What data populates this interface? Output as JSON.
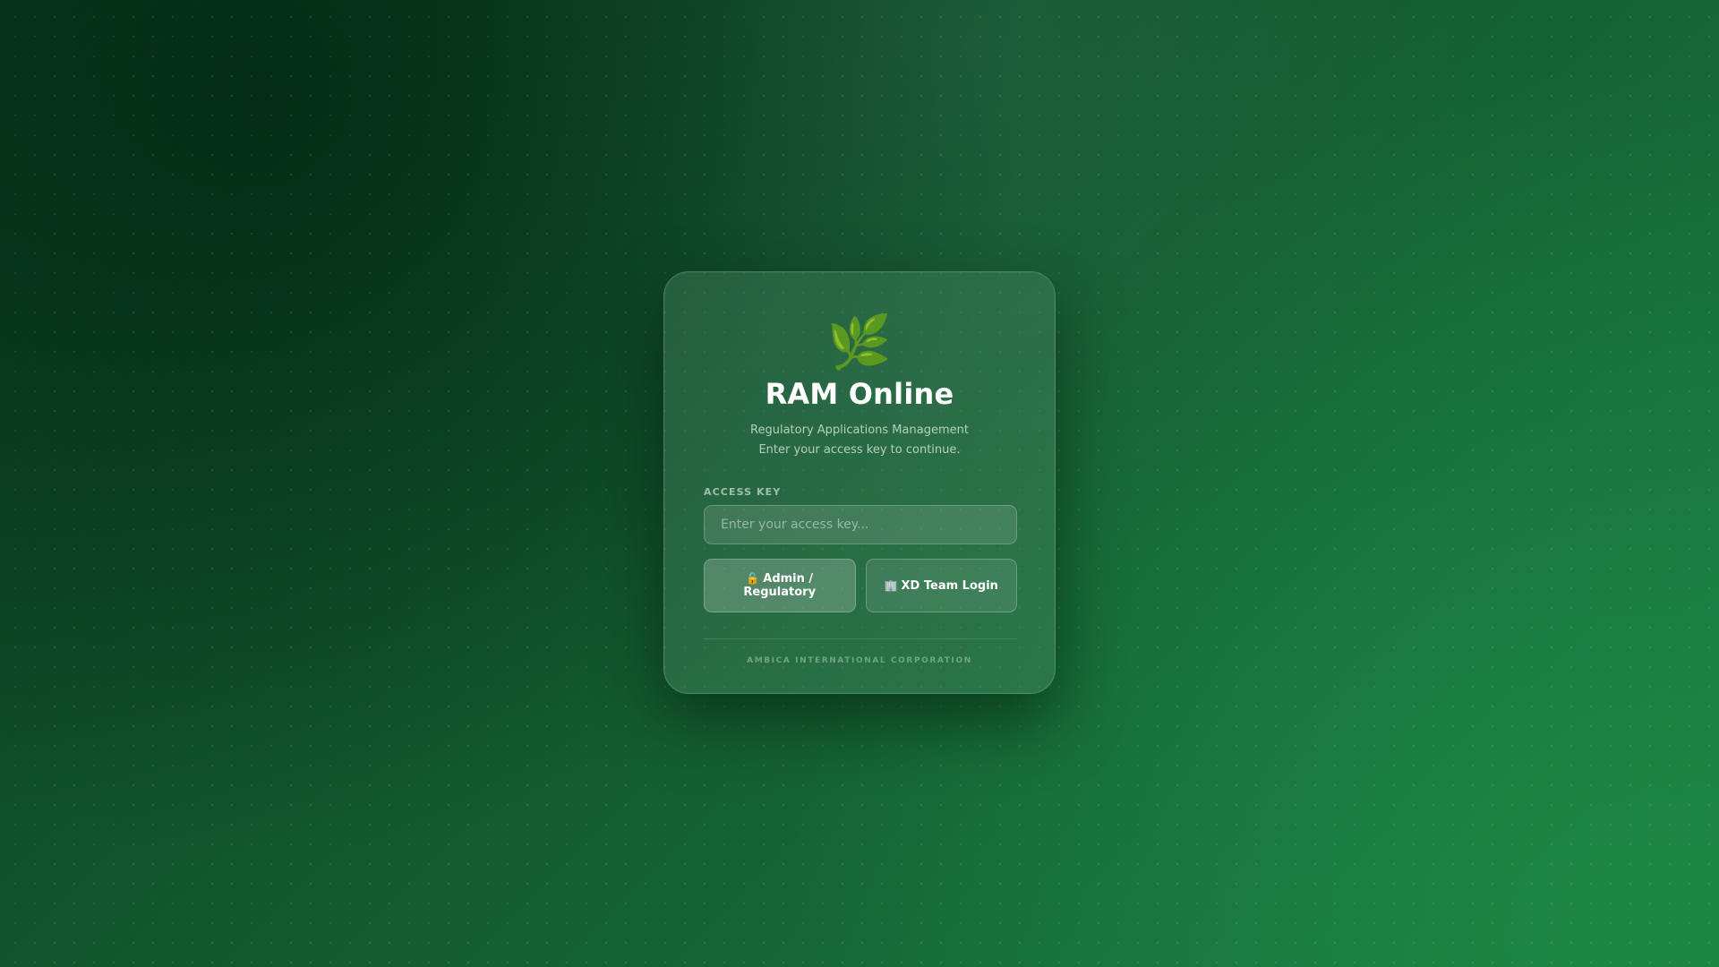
{
  "app": {
    "logo_icon": "🌿",
    "title": "RAM Online",
    "subtitle": "Regulatory Applications Management",
    "instruction": "Enter your access key to continue."
  },
  "form": {
    "access_key_label": "ACCESS KEY",
    "access_key_placeholder": "Enter your access key...",
    "access_key_value": ""
  },
  "buttons": {
    "admin_icon": "🔓",
    "admin_label": "Admin / Regulatory",
    "team_icon": "🏢",
    "team_label": "XD Team Login"
  },
  "footer": {
    "company": "AMBICA INTERNATIONAL CORPORATION"
  },
  "colors": {
    "background_dark": "#0a3a20",
    "background_light": "#1a7a42",
    "text_primary": "#ffffff"
  }
}
